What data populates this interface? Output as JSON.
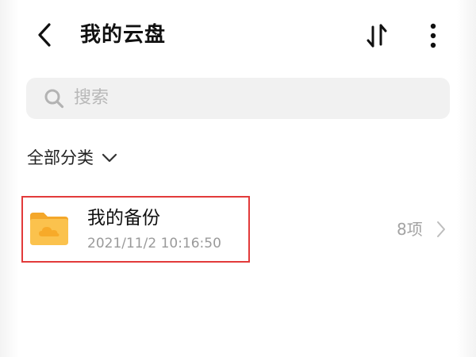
{
  "header": {
    "back_icon": "chevron-left-icon",
    "title": "我的云盘",
    "sort_icon": "sort-icon",
    "more_icon": "more-vertical-icon"
  },
  "search": {
    "icon": "search-icon",
    "placeholder": "搜索"
  },
  "filter": {
    "label": "全部分类",
    "icon": "chevron-down-icon"
  },
  "files": [
    {
      "icon": "cloud-folder-icon",
      "name": "我的备份",
      "date": "2021/11/2 10:16:50",
      "count": "8项",
      "highlighted": true
    }
  ],
  "colors": {
    "accent_folder": "#f8b531",
    "highlight": "#e23a3a",
    "search_bg": "#f1f1f1"
  }
}
